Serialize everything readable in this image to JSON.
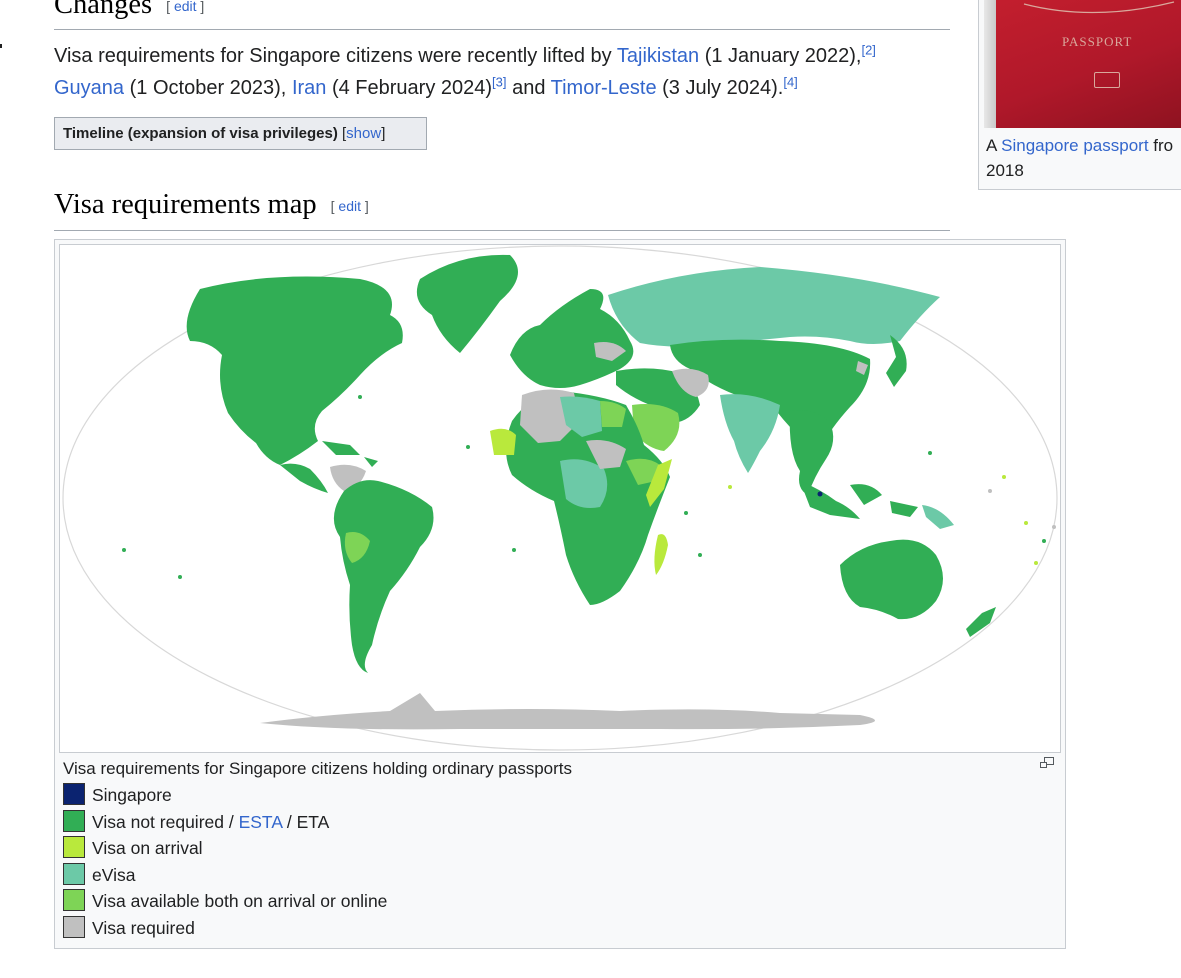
{
  "changes": {
    "heading": "Changes",
    "edit_open": "[ ",
    "edit_label": "edit",
    "edit_close": " ]",
    "para": {
      "t1": "Visa requirements for Singapore citizens were recently lifted by ",
      "link1": "Tajikistan",
      "t2": " (1 January 2022),",
      "ref1": "[2]",
      "link2": "Guyana",
      "t3": " (1 October 2023), ",
      "link3": "Iran",
      "t4": " (4 February 2024)",
      "ref2": "[3]",
      "t5": " and ",
      "link4": "Timor-Leste",
      "t6": " (3 July 2024).",
      "ref3": "[4]"
    },
    "timeline": {
      "title": "Timeline (expansion of visa privileges)",
      "bracket_open": " [",
      "toggle": "show",
      "bracket_close": "]"
    }
  },
  "thumb": {
    "image_text": "PASSPORT",
    "caption_prefix": "A ",
    "caption_link": "Singapore passport",
    "caption_suffix": " fro",
    "caption_line2": "2018"
  },
  "map_section": {
    "heading": "Visa requirements map",
    "edit_open": "[ ",
    "edit_label": "edit",
    "edit_close": " ]",
    "caption": "Visa requirements for Singapore citizens holding ordinary passports",
    "legend": [
      {
        "label": "Singapore",
        "color": "#0b2370"
      },
      {
        "label_pre": "Visa not required / ",
        "label_link": "ESTA",
        "label_post": " / ETA",
        "color": "#31ae55"
      },
      {
        "label": "Visa on arrival",
        "color": "#b9e93c"
      },
      {
        "label": "eVisa",
        "color": "#6cc9a7"
      },
      {
        "label": "Visa available both on arrival or online",
        "color": "#7ed456"
      },
      {
        "label": "Visa required",
        "color": "#c0c0c0"
      }
    ]
  }
}
